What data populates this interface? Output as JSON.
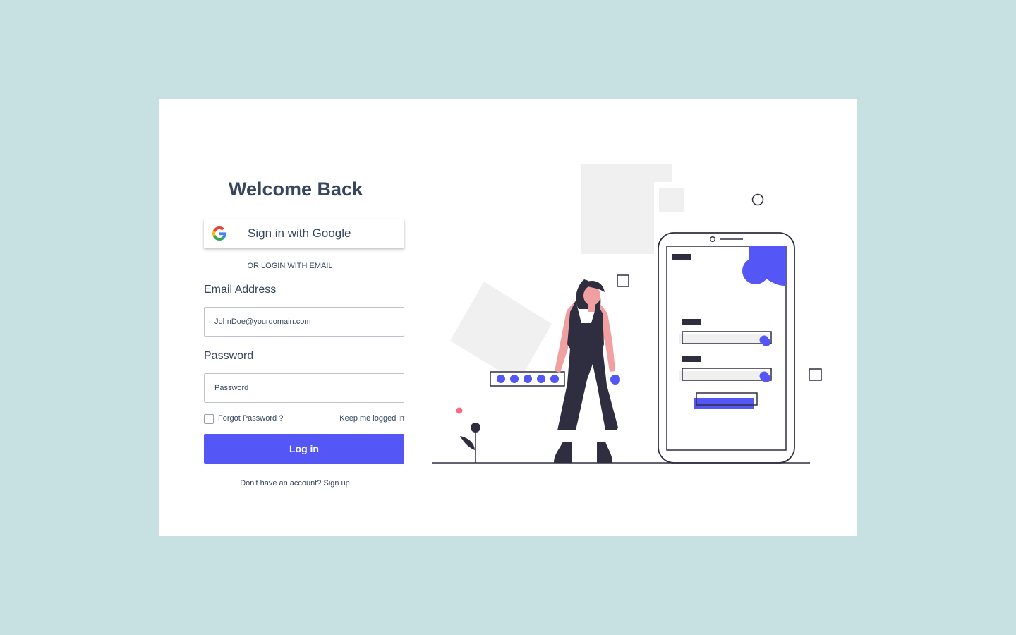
{
  "login": {
    "title": "Welcome Back",
    "google_button_label": "Sign in with Google",
    "divider_text": "OR LOGIN WITH EMAIL",
    "email_label": "Email Address",
    "email_placeholder": "JohnDoe@yourdomain.com",
    "password_label": "Password",
    "password_placeholder": "Password",
    "forgot_password": "Forgot Password ?",
    "keep_logged_in": "Keep me logged in",
    "login_button": "Log in",
    "signup_text": "Don't have an account? Sign up"
  },
  "colors": {
    "background": "#c7e1e2",
    "card": "#ffffff",
    "text": "#36465e",
    "accent": "#5457f5",
    "illustration_dark": "#2f2e41",
    "illustration_skin": "#f0a0a0",
    "illustration_grey": "#f0f0f0",
    "illustration_pink": "#ff6584"
  },
  "icons": {
    "google": "google-g-icon"
  }
}
